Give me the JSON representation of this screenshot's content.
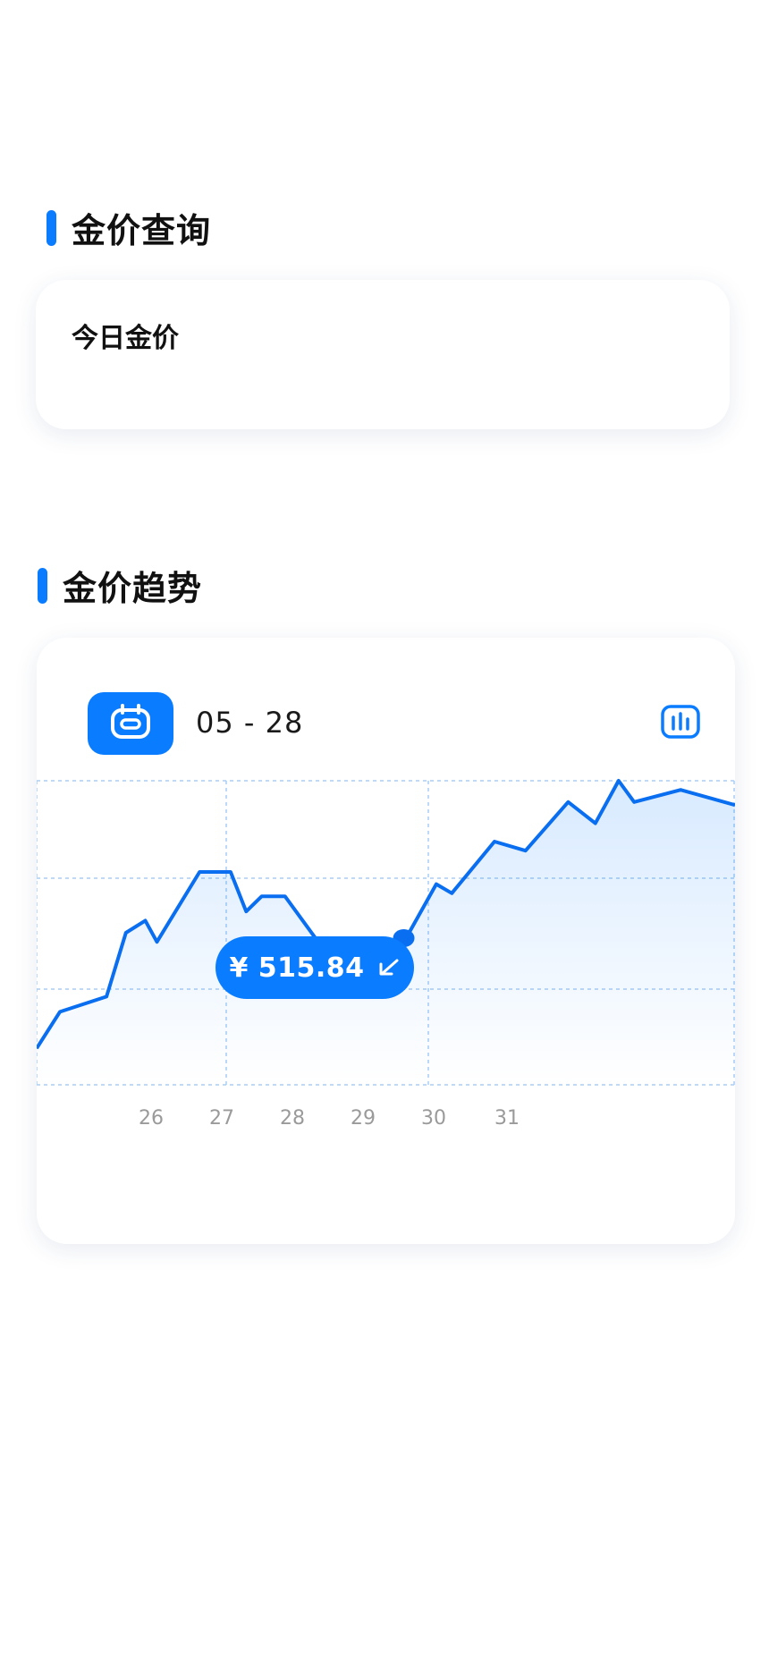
{
  "sections": {
    "query_title": "金价查询",
    "trend_title": "金价趋势"
  },
  "today_card": {
    "title": "今日金价"
  },
  "trend_card": {
    "date": "05 - 28",
    "calendar_icon": "calendar-icon",
    "chart_toggle_icon": "bar-chart-icon",
    "tooltip": {
      "currency": "¥",
      "value": "515.84",
      "label": "¥ 515.84",
      "trend_icon": "arrow-down-left-icon"
    }
  },
  "colors": {
    "accent": "#0a7cff",
    "line": "#0a6ef0",
    "grid": "#a9cdf5",
    "tick": "#9a9a9a"
  },
  "chart_data": {
    "type": "area",
    "x_tick_labels": [
      "26",
      "27",
      "28",
      "29",
      "30",
      "31"
    ],
    "points": [
      [
        0.0,
        0.12
      ],
      [
        0.3,
        0.24
      ],
      [
        0.9,
        0.29
      ],
      [
        1.15,
        0.5
      ],
      [
        1.4,
        0.54
      ],
      [
        1.55,
        0.47
      ],
      [
        2.1,
        0.7
      ],
      [
        2.5,
        0.7
      ],
      [
        2.7,
        0.57
      ],
      [
        2.9,
        0.62
      ],
      [
        3.2,
        0.62
      ],
      [
        3.6,
        0.48
      ],
      [
        3.85,
        0.38
      ],
      [
        4.4,
        0.47
      ],
      [
        4.6,
        0.4
      ],
      [
        4.8,
        0.5
      ],
      [
        5.15,
        0.66
      ],
      [
        5.35,
        0.63
      ],
      [
        5.9,
        0.8
      ],
      [
        6.3,
        0.77
      ],
      [
        6.85,
        0.93
      ],
      [
        7.2,
        0.86
      ],
      [
        7.5,
        1.0
      ],
      [
        7.7,
        0.93
      ],
      [
        8.3,
        0.97
      ],
      [
        9.0,
        0.92
      ]
    ],
    "x_range": [
      0,
      9
    ],
    "y_range": [
      0,
      1
    ],
    "highlight_index": 15,
    "grid": true,
    "legend": "none"
  }
}
